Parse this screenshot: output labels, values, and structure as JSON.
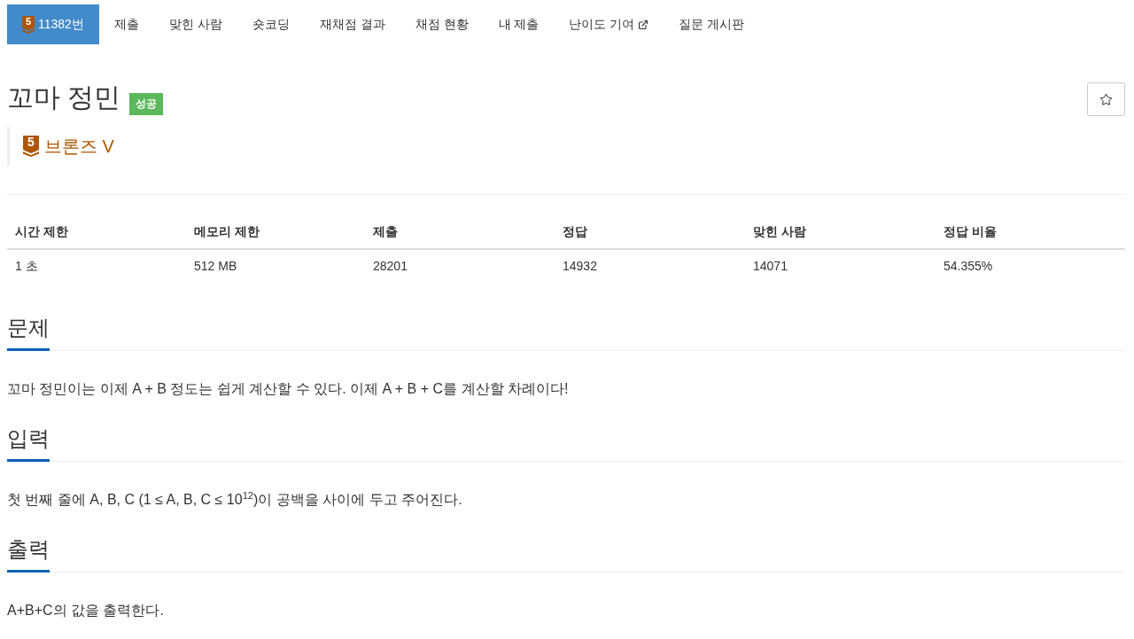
{
  "nav": {
    "tabs": [
      {
        "kind": "problem",
        "tier_number": "5",
        "label": "11382번",
        "selected": true
      },
      {
        "kind": "link",
        "label": "제출",
        "selected": false
      },
      {
        "kind": "link",
        "label": "맞힌 사람",
        "selected": false
      },
      {
        "kind": "link",
        "label": "숏코딩",
        "selected": false
      },
      {
        "kind": "link",
        "label": "재채점 결과",
        "selected": false
      },
      {
        "kind": "link",
        "label": "채점 현황",
        "selected": false
      },
      {
        "kind": "link",
        "label": "내 제출",
        "selected": false
      },
      {
        "kind": "external",
        "label": "난이도 기여",
        "selected": false
      },
      {
        "kind": "link",
        "label": "질문 게시판",
        "selected": false
      }
    ]
  },
  "problem": {
    "title": "꼬마 정민",
    "status_badge": "성공",
    "starred": false,
    "tier": {
      "number": "5",
      "name": "브론즈 V"
    }
  },
  "limits_table": {
    "columns": [
      "시간 제한",
      "메모리 제한",
      "제출",
      "정답",
      "맞힌 사람",
      "정답 비율"
    ],
    "rows": [
      [
        "1 초",
        "512 MB",
        "28201",
        "14932",
        "14071",
        "54.355%"
      ]
    ]
  },
  "sections": [
    {
      "title": "문제",
      "text": "꼬마 정민이는 이제 A + B 정도는 쉽게 계산할 수 있다. 이제 A + B + C를 계산할 차례이다!"
    },
    {
      "title": "입력",
      "text": "첫 번째 줄에 A, B, C (1 ≤ A, B, C ≤ 10$^{12}$)이 공백을 사이에 두고 주어진다."
    },
    {
      "title": "출력",
      "text": "A+B+C의 값을 출력한다."
    }
  ]
}
